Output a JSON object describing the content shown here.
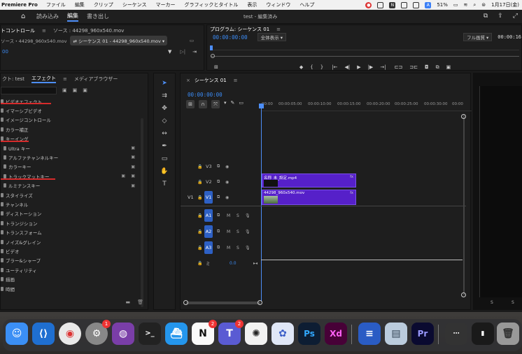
{
  "menubar": {
    "app": "Premiere Pro",
    "items": [
      "ファイル",
      "編集",
      "クリップ",
      "シーケンス",
      "マーカー",
      "グラフィックとタイトル",
      "表示",
      "ウィンドウ",
      "ヘルプ"
    ],
    "battery": "51%",
    "date": "1月17日(金)"
  },
  "workspace": {
    "tabs": [
      "読み込み",
      "編集",
      "書き出し"
    ],
    "active_tab": "編集",
    "title": "test - 編集済み"
  },
  "source_panel": {
    "tab1": "トコントロール",
    "tab2": "ソース : 44298_960x540.mov",
    "sub1": "ソース・44298_960x540.mov",
    "sub2": "シーケンス 01 - 44298_960x540.mov",
    "timecode": "00"
  },
  "program_panel": {
    "title": "プログラム: シーケンス 01",
    "timecode": "00:00:00:00",
    "fit": "全体表示",
    "quality": "フル画質",
    "timecode_right": "00:00:16"
  },
  "effects_panel": {
    "tabs": [
      "クト: test",
      "エフェクト",
      "メディアブラウザー"
    ],
    "active_tab": "エフェクト",
    "items": [
      {
        "label": "ビデオエフェクト",
        "level": 0
      },
      {
        "label": "イマーシブビデオ",
        "level": 0
      },
      {
        "label": "イメージコントロール",
        "level": 0
      },
      {
        "label": "カラー補正",
        "level": 0
      },
      {
        "label": "キーイング",
        "level": 0
      },
      {
        "label": "Ultra キー",
        "level": 1
      },
      {
        "label": "アルファチャンネルキー",
        "level": 1
      },
      {
        "label": "カラーキー",
        "level": 1
      },
      {
        "label": "トラックマットキー",
        "level": 1
      },
      {
        "label": "ルミナンスキー",
        "level": 1
      },
      {
        "label": "スタイライズ",
        "level": 0
      },
      {
        "label": "チャンネル",
        "level": 0
      },
      {
        "label": "ディストーション",
        "level": 0
      },
      {
        "label": "トランジション",
        "level": 0
      },
      {
        "label": "トランスフォーム",
        "level": 0
      },
      {
        "label": "ノイズ&グレイン",
        "level": 0
      },
      {
        "label": "ビデオ",
        "level": 0
      },
      {
        "label": "ブラー&シャープ",
        "level": 0
      },
      {
        "label": "ユーティリティ",
        "level": 0
      },
      {
        "label": "描画",
        "level": 0
      },
      {
        "label": "時間",
        "level": 0
      }
    ]
  },
  "timeline": {
    "tab": "シーケンス 01",
    "timecode": "00:00:00:00",
    "ruler": [
      "00:00",
      "00:00:05:00",
      "00:00:10:00",
      "00:00:15:00",
      "00:00:20:00",
      "00:00:25:00",
      "00:00:30:00",
      "00:00"
    ],
    "tracks": [
      {
        "name": "V3",
        "type": "video"
      },
      {
        "name": "V2",
        "type": "video"
      },
      {
        "name": "V1",
        "type": "video",
        "source": "V1"
      },
      {
        "name": "A1",
        "type": "audio"
      },
      {
        "name": "A2",
        "type": "audio"
      },
      {
        "name": "A3",
        "type": "audio"
      }
    ],
    "master": {
      "label": "ミ",
      "value": "0.0"
    },
    "clip_v2": "名称_未_設定.mp4",
    "clip_v1": "44298_960x540.mov",
    "mute_label": "M",
    "solo_label": "S",
    "fx": "fx"
  },
  "meters": {
    "labels": [
      "S",
      "S"
    ]
  },
  "dock": {
    "apps": [
      {
        "name": "Finder",
        "color": "#3b8ff5"
      },
      {
        "name": "VS Code",
        "color": "#1f6fd1"
      },
      {
        "name": "Chrome",
        "color": "#e9e9e9"
      },
      {
        "name": "System Settings",
        "color": "#888",
        "badge": "1"
      },
      {
        "name": "GitHub Desktop",
        "color": "#7a3ea8"
      },
      {
        "name": "Terminal",
        "color": "#222"
      },
      {
        "name": "Docker",
        "color": "#2496ed"
      },
      {
        "name": "Notion",
        "color": "#fafafa",
        "badge": "2"
      },
      {
        "name": "Teams",
        "color": "#5a5bd3",
        "badge": "2"
      },
      {
        "name": "ChatGPT",
        "color": "#f2f2f2"
      },
      {
        "name": "Affinity",
        "color": "#e0e7f7"
      },
      {
        "name": "Ps",
        "color": "#0d1d33"
      },
      {
        "name": "Xd",
        "color": "#470137"
      },
      {
        "name": "Docs",
        "color": "#2a5cc4"
      },
      {
        "name": "Preview",
        "color": "#bcd"
      },
      {
        "name": "Pr",
        "color": "#0a0a30"
      },
      {
        "name": "Trash",
        "color": "#999"
      }
    ]
  }
}
